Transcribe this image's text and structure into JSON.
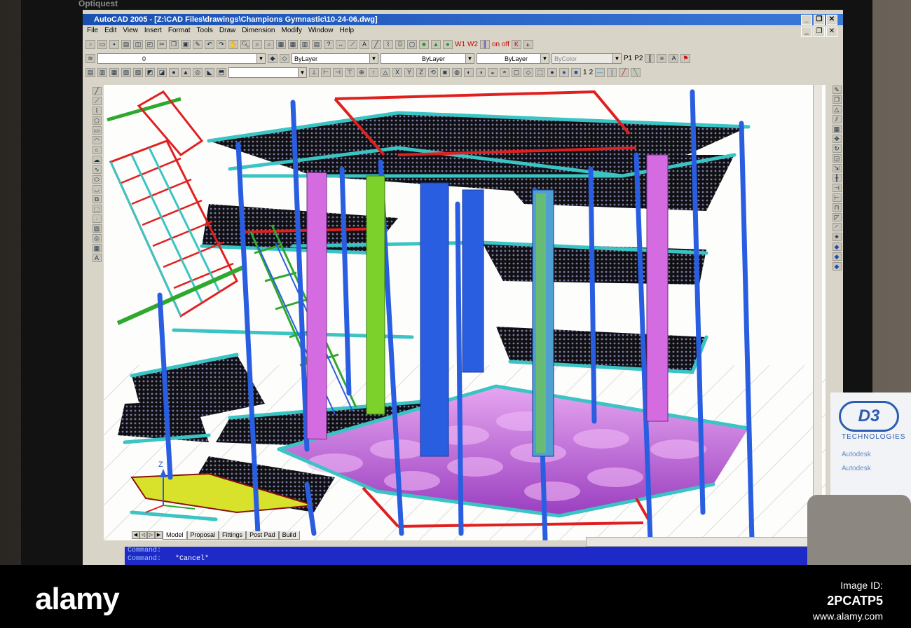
{
  "monitor": {
    "brand": "Optiquest"
  },
  "window": {
    "title": "AutoCAD 2005 - [Z:\\CAD Files\\drawings\\Champions Gymnastic\\10-24-06.dwg]",
    "buttons": [
      "_",
      "❐",
      "✕"
    ]
  },
  "menu": [
    "File",
    "Edit",
    "View",
    "Insert",
    "Format",
    "Tools",
    "Draw",
    "Dimension",
    "Modify",
    "Window",
    "Help"
  ],
  "toolbar": {
    "layer_value": "0",
    "color_value": "ByLayer",
    "linetype_value": "ByLayer",
    "lineweight_value": "ByLayer",
    "plotstyle_value": "ByColor",
    "labels": {
      "w1": "W1",
      "w2": "W2",
      "on": "on",
      "off": "off",
      "p1": "P1",
      "p2": "P2",
      "n1": "1",
      "n2": "2"
    }
  },
  "layout_tabs": [
    "Model",
    "Proposal",
    "Fittings",
    "Post Pad",
    "Build"
  ],
  "command_line": {
    "line1": "Command:",
    "line2": "Command:",
    "cancel": "*Cancel*"
  },
  "sign": {
    "logo": "D3",
    "line1": "TECHNOLOGIES",
    "line2": "Autodesk",
    "line3": "Autodesk"
  },
  "axis_label": "Z",
  "stock": {
    "logo": "alamy",
    "image_id": "2PCATP5",
    "site": "www.alamy.com"
  },
  "colors": {
    "frame_blue": "#2a5ee0",
    "rail_cyan": "#3bc4c4",
    "beam_red": "#e02020",
    "panel_magenta": "#d56be0",
    "panel_green": "#7cd12a",
    "mat_purple": "#c46ee6",
    "cmd_blue": "#1d2ac8"
  }
}
